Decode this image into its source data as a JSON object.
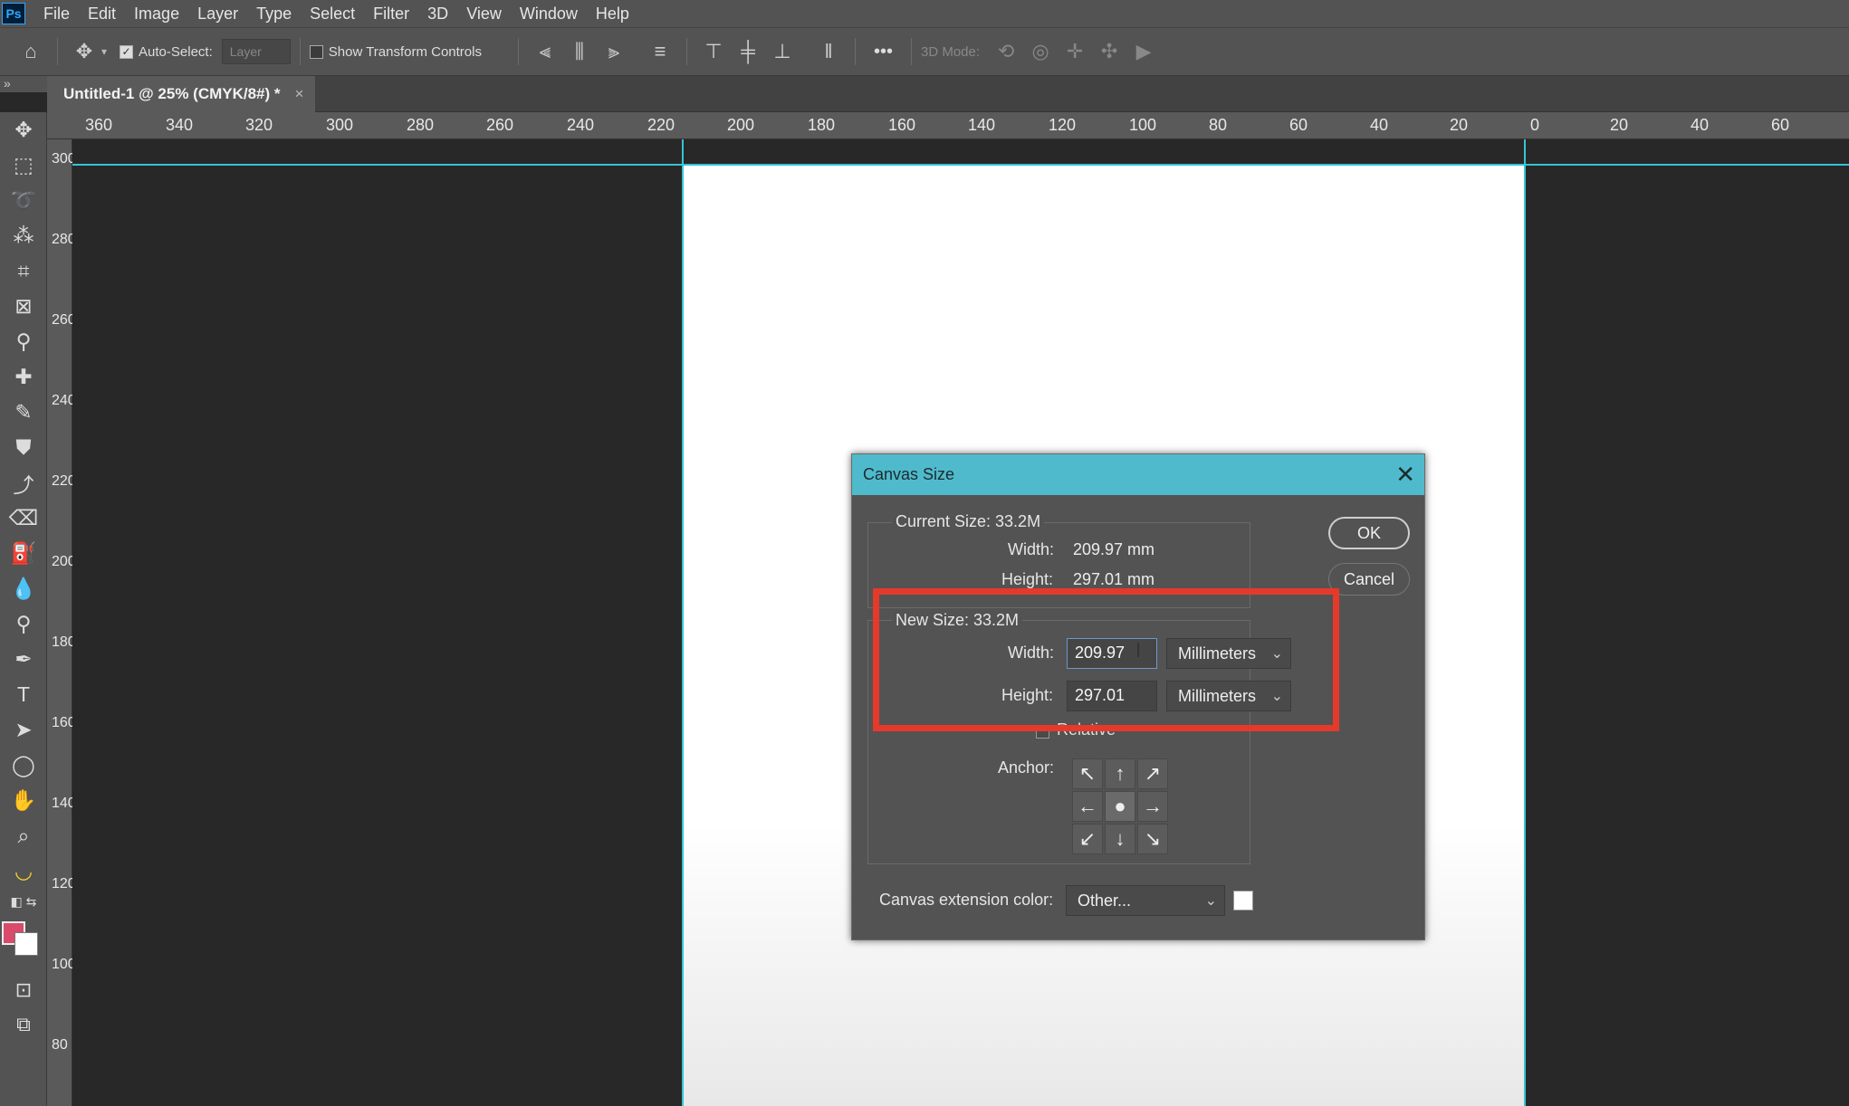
{
  "menubar": {
    "logo": "Ps",
    "items": [
      "File",
      "Edit",
      "Image",
      "Layer",
      "Type",
      "Select",
      "Filter",
      "3D",
      "View",
      "Window",
      "Help"
    ]
  },
  "options": {
    "auto_select_label": "Auto-Select:",
    "auto_select_target": "Layer",
    "show_transform_label": "Show Transform Controls",
    "more": "•••",
    "three_d_mode": "3D Mode:"
  },
  "document": {
    "tab_title": "Untitled-1 @ 25% (CMYK/8#) *",
    "tab_close": "×"
  },
  "rulers": {
    "horizontal": [
      "360",
      "340",
      "320",
      "300",
      "280",
      "260",
      "240",
      "220",
      "200",
      "180",
      "160",
      "140",
      "120",
      "100",
      "80",
      "60",
      "40",
      "20",
      "0",
      "20",
      "40",
      "60"
    ],
    "vertical": [
      "300",
      "280",
      "260",
      "240",
      "220",
      "200",
      "180",
      "160",
      "140",
      "120",
      "100",
      "80"
    ]
  },
  "dialog": {
    "title": "Canvas Size",
    "close": "✕",
    "current_size": "Current Size: 33.2M",
    "width_label": "Width:",
    "height_label": "Height:",
    "current_width": "209.97 mm",
    "current_height": "297.01 mm",
    "new_size": "New Size: 33.2M",
    "new_width": "209.97",
    "new_height": "297.01",
    "width_unit": "Millimeters",
    "height_unit": "Millimeters",
    "relative_label": "Relative",
    "anchor_label": "Anchor:",
    "anchor_arrows": [
      "↖",
      "↑",
      "↗",
      "←",
      "●",
      "→",
      "↙",
      "↓",
      "↘"
    ],
    "extension_label": "Canvas extension color:",
    "extension_value": "Other...",
    "ok": "OK",
    "cancel": "Cancel"
  },
  "colors": {
    "foreground": "#d94a6b",
    "background": "#ffffff",
    "highlight": "#e53a2b",
    "dialog_title": "#4fbacb"
  }
}
